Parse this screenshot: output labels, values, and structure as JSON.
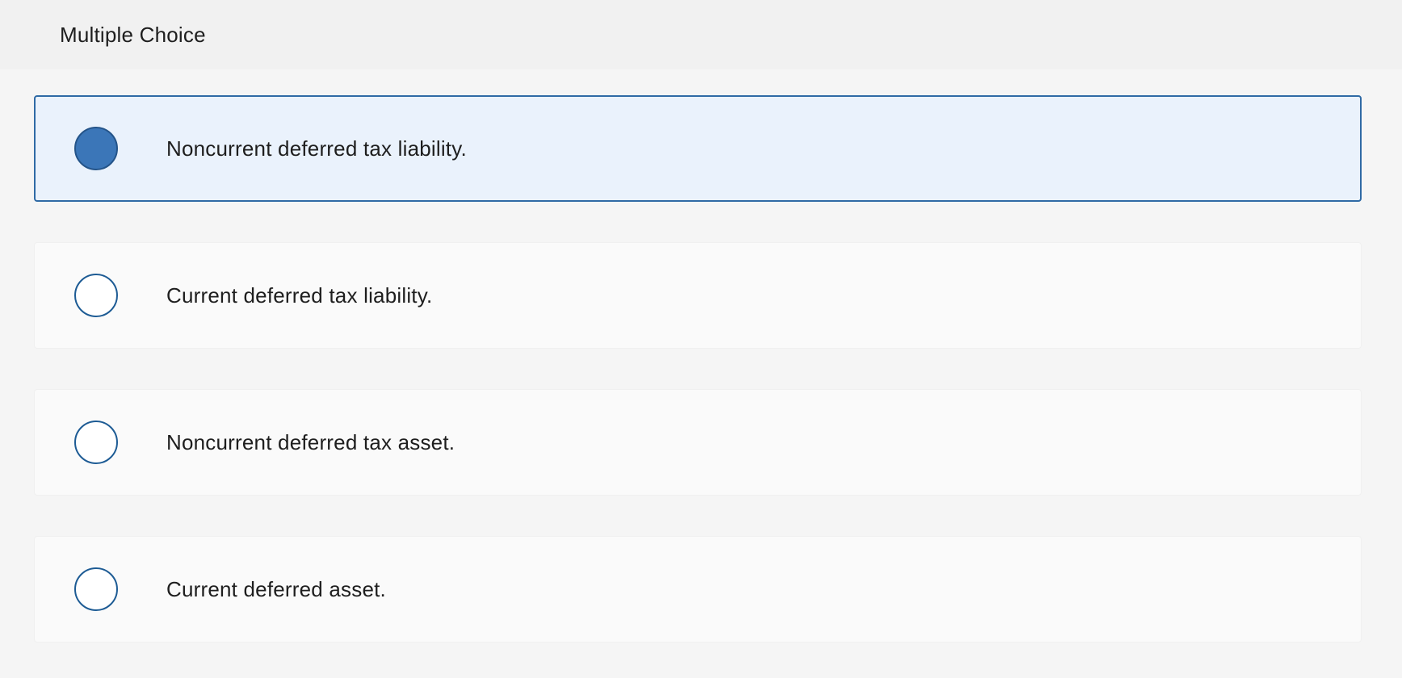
{
  "header": {
    "title": "Multiple Choice"
  },
  "options": [
    {
      "label": "Noncurrent deferred tax liability.",
      "selected": true
    },
    {
      "label": "Current deferred tax liability.",
      "selected": false
    },
    {
      "label": "Noncurrent deferred tax asset.",
      "selected": false
    },
    {
      "label": "Current deferred asset.",
      "selected": false
    }
  ],
  "colors": {
    "selected_fill": "#3b76b8",
    "radio_border": "#1d5b94",
    "selected_background": "#eaf2fc"
  }
}
